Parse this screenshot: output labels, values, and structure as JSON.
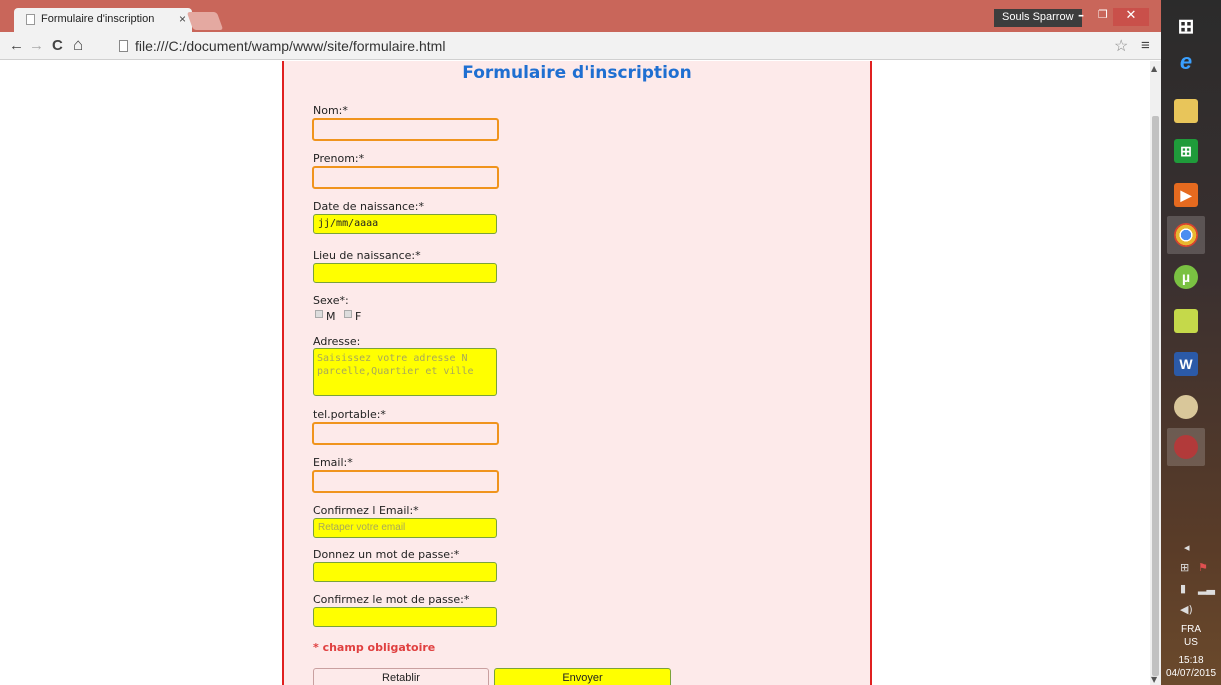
{
  "browser": {
    "tab_title": "Formulaire d'inscription",
    "tab_close": "×",
    "user": "Souls Sparrow",
    "url": "file:///C:/document/wamp/www/site/formulaire.html",
    "window_controls": {
      "minimize": "–",
      "restore": "❐",
      "close": "✕"
    },
    "nav": {
      "back": "←",
      "forward": "→",
      "reload": "C",
      "home": "⌂"
    },
    "star": "☆",
    "menu": "≡"
  },
  "form": {
    "title": "Formulaire d'inscription",
    "fields": {
      "nom_label": "Nom:*",
      "prenom_label": "Prenom:*",
      "date_label": "Date de naissance:*",
      "date_value": "jj/mm/aaaa",
      "lieu_label": "Lieu de naissance:*",
      "sexe_label": "Sexe*:",
      "sexe_m": "M",
      "sexe_f": "F",
      "adresse_label": "Adresse:",
      "adresse_placeholder": "Saisissez votre adresse N parcelle,Quartier et ville",
      "tel_label": "tel.portable:*",
      "email_label": "Email:*",
      "confirm_email_label": "Confirmez l Email:*",
      "confirm_email_placeholder": "Retaper votre email",
      "password_label": "Donnez un mot de passe:*",
      "confirm_password_label": "Confirmez le mot de passe:*"
    },
    "required_note": "* champ obligatoire",
    "reset_button": "Retablir",
    "submit_button": "Envoyer"
  },
  "taskbar": {
    "apps": [
      "start-icon",
      "internet-explorer-icon",
      "file-explorer-icon",
      "store-icon",
      "media-player-icon",
      "chrome-icon",
      "utorrent-icon",
      "chart-app-icon",
      "word-icon",
      "paint-icon",
      "tools-icon"
    ],
    "language": "FRA",
    "region": "US",
    "time": "15:18",
    "date": "04/07/2015"
  },
  "colors": {
    "titlebar": "#c9665a",
    "panel_bg": "#fdeaea",
    "panel_border": "#e02020",
    "title_blue": "#1f6fd1",
    "field_yellow": "#ffff00",
    "focus_orange": "#f0941d",
    "required_red": "#e04040"
  }
}
